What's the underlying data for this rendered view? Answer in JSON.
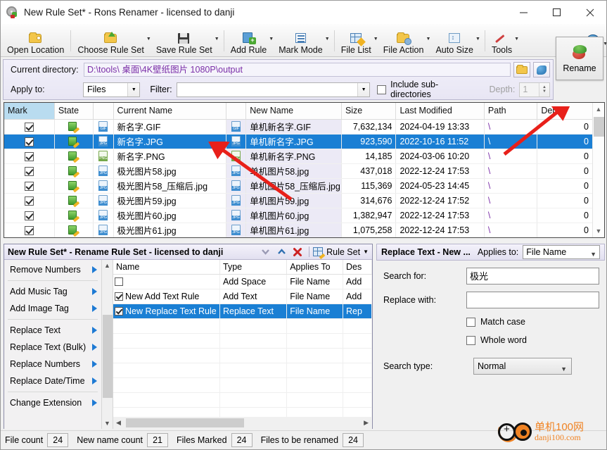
{
  "window": {
    "title": "New Rule Set* - Rons Renamer - licensed to danji",
    "icon": "app-gear-icon",
    "controls": {
      "minimize": "—",
      "maximize": "☐",
      "close": "✕"
    }
  },
  "toolbar": {
    "items": [
      {
        "label": "Open Location",
        "icon": "open-folder-icon",
        "dropdown": false
      },
      {
        "label": "Choose Rule Set",
        "icon": "folder-up-icon",
        "dropdown": true
      },
      {
        "label": "Save Rule Set",
        "icon": "floppy-disk-icon",
        "dropdown": true
      },
      {
        "label": "Add Rule",
        "icon": "add-page-icon",
        "dropdown": true
      },
      {
        "label": "Mark Mode",
        "icon": "list-icon",
        "dropdown": true
      },
      {
        "label": "File List",
        "icon": "grid-edit-icon",
        "dropdown": true
      },
      {
        "label": "File Action",
        "icon": "folder-gear-icon",
        "dropdown": true
      },
      {
        "label": "Auto Size",
        "icon": "auto-size-icon",
        "dropdown": true
      },
      {
        "label": "Tools",
        "icon": "wand-icon",
        "dropdown": true
      }
    ],
    "info": {
      "icon": "info-icon",
      "glyph": "i"
    }
  },
  "directory_panel": {
    "current_directory_label": "Current directory:",
    "current_directory_value": "D:\\tools\\ 桌面\\4K壁纸图片 1080P\\output",
    "browse_icon": "browse-folder-icon",
    "refresh_icon": "refresh-globe-icon",
    "apply_to_label": "Apply to:",
    "apply_to_value": "Files",
    "filter_label": "Filter:",
    "filter_value": "",
    "include_subdirs_label": "Include sub-directories",
    "include_subdirs_checked": false,
    "depth_label": "Depth:",
    "depth_value": "1",
    "rename_button": "Rename",
    "rename_icon": "rename-arrows-icon"
  },
  "file_table": {
    "columns": [
      "Mark",
      "State",
      "",
      "Current Name",
      "",
      "New Name",
      "Size",
      "Last Modified",
      "Path",
      "Depth"
    ],
    "rows": [
      {
        "marked": true,
        "state": "editable-icon",
        "type": "GIF",
        "current": "新名字.GIF",
        "new": "单机新名字.GIF",
        "size": "7,632,134",
        "modified": "2024-04-19 13:33",
        "path": "\\",
        "depth": "0",
        "selected": false
      },
      {
        "marked": true,
        "state": "editable-icon",
        "type": "JPG",
        "current": "新名字.JPG",
        "new": "单机新名字.JPG",
        "size": "923,590",
        "modified": "2022-10-16 11:52",
        "path": "\\",
        "depth": "0",
        "selected": true
      },
      {
        "marked": true,
        "state": "editable-icon",
        "type": "PNG",
        "current": "新名字.PNG",
        "new": "单机新名字.PNG",
        "size": "14,185",
        "modified": "2024-03-06 10:20",
        "path": "\\",
        "depth": "0",
        "selected": false
      },
      {
        "marked": true,
        "state": "editable-icon",
        "type": "JPG",
        "current": "极光图片58.jpg",
        "new": "单机图片58.jpg",
        "size": "437,018",
        "modified": "2022-12-24 17:53",
        "path": "\\",
        "depth": "0",
        "selected": false
      },
      {
        "marked": true,
        "state": "editable-icon",
        "type": "JPG",
        "current": "极光图片58_压缩后.jpg",
        "new": "单机图片58_压缩后.jpg",
        "size": "115,369",
        "modified": "2024-05-23 14:45",
        "path": "\\",
        "depth": "0",
        "selected": false
      },
      {
        "marked": true,
        "state": "editable-icon",
        "type": "JPG",
        "current": "极光图片59.jpg",
        "new": "单机图片59.jpg",
        "size": "314,676",
        "modified": "2022-12-24 17:52",
        "path": "\\",
        "depth": "0",
        "selected": false
      },
      {
        "marked": true,
        "state": "editable-icon",
        "type": "JPG",
        "current": "极光图片60.jpg",
        "new": "单机图片60.jpg",
        "size": "1,382,947",
        "modified": "2022-12-24 17:53",
        "path": "\\",
        "depth": "0",
        "selected": false
      },
      {
        "marked": true,
        "state": "editable-icon",
        "type": "JPG",
        "current": "极光图片61.jpg",
        "new": "单机图片61.jpg",
        "size": "1,075,258",
        "modified": "2022-12-24 17:53",
        "path": "\\",
        "depth": "0",
        "selected": false
      }
    ]
  },
  "rule_panel": {
    "title": "New Rule Set* - Rename Rule Set - licensed to danji",
    "move_down_icon": "chevron-down-icon",
    "move_up_icon": "chevron-up-icon",
    "delete_icon": "red-x-icon",
    "rule_set_label": "Rule Set",
    "rule_set_icon": "grid-edit-icon",
    "rule_set_dropdown": "▾",
    "categories": [
      {
        "label": "Remove Numbers",
        "has_submenu": true
      },
      {
        "label": "Add Music Tag",
        "has_submenu": true
      },
      {
        "label": "Add Image Tag",
        "has_submenu": true
      },
      {
        "label": "Replace Text",
        "has_submenu": true
      },
      {
        "label": "Replace Text (Bulk)",
        "has_submenu": true
      },
      {
        "label": "Replace Numbers",
        "has_submenu": true
      },
      {
        "label": "Replace Date/Time",
        "has_submenu": true
      },
      {
        "label": "Change Extension",
        "has_submenu": true
      }
    ],
    "table": {
      "columns": [
        "Name",
        "Type",
        "Applies To",
        "Des"
      ],
      "rows": [
        {
          "checked": false,
          "name": "",
          "type": "Add Space",
          "applies_to": "File Name",
          "desc": "Add",
          "selected": false
        },
        {
          "checked": true,
          "name": "New Add Text Rule",
          "type": "Add Text",
          "applies_to": "File Name",
          "desc": "Add",
          "selected": false
        },
        {
          "checked": true,
          "name": "New Replace Text Rule",
          "type": "Replace Text",
          "applies_to": "File Name",
          "desc": "Rep",
          "selected": true
        }
      ]
    }
  },
  "replace_panel": {
    "title": "Replace Text - New ...",
    "applies_to_label": "Applies to:",
    "applies_to_value": "File Name",
    "search_for_label": "Search for:",
    "search_for_value": "极光",
    "replace_with_label": "Replace with:",
    "replace_with_value": "",
    "match_case_label": "Match case",
    "match_case_checked": false,
    "whole_word_label": "Whole word",
    "whole_word_checked": false,
    "search_type_label": "Search type:",
    "search_type_value": "Normal"
  },
  "status_bar": {
    "items": [
      {
        "label": "File count",
        "value": "24"
      },
      {
        "label": "New name count",
        "value": "21"
      },
      {
        "label": "Files Marked",
        "value": "24"
      },
      {
        "label": "Files to be renamed",
        "value": "24"
      }
    ]
  },
  "watermark": {
    "chinese": "单机100网",
    "english": "danji100.com"
  },
  "colors": {
    "selection_blue": "#1a7fd4",
    "mark_header_blue": "#b9dcf0",
    "path_purple": "#7b2fa8",
    "new_name_bg": "#eceaf6",
    "accent_orange": "#f08323",
    "arrow_red": "#e8201a"
  }
}
